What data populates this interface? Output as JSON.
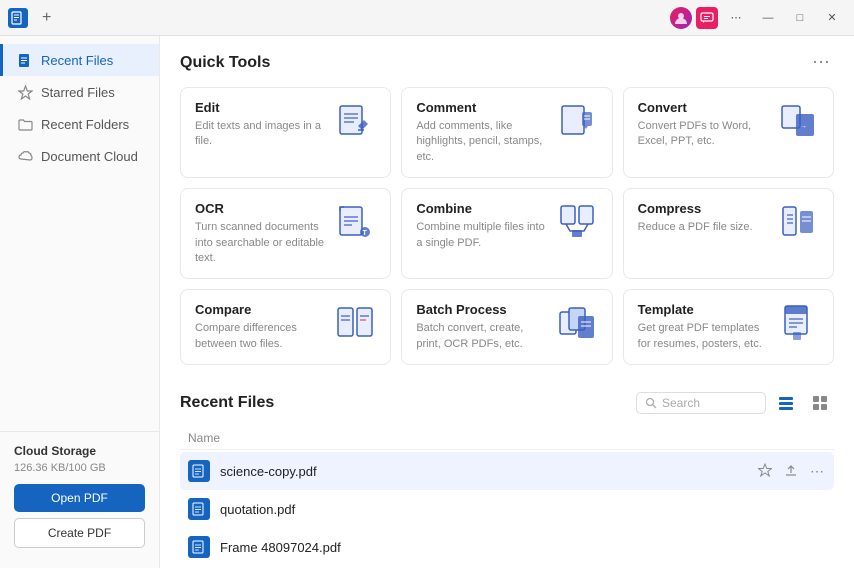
{
  "titlebar": {
    "app_name": "PDF",
    "add_label": "+",
    "dots_label": "⋯",
    "minimize_label": "—",
    "maximize_label": "□",
    "close_label": "✕"
  },
  "sidebar": {
    "items": [
      {
        "id": "recent-files",
        "label": "Recent Files",
        "icon": "📄",
        "active": true
      },
      {
        "id": "starred-files",
        "label": "Starred Files",
        "icon": "☆",
        "active": false
      },
      {
        "id": "recent-folders",
        "label": "Recent Folders",
        "icon": "📁",
        "active": false
      },
      {
        "id": "document-cloud",
        "label": "Document Cloud",
        "icon": "☁",
        "active": false
      }
    ],
    "cloud_storage": {
      "label": "Cloud Storage",
      "size": "126.36 KB/100 GB",
      "open_pdf_label": "Open PDF",
      "create_pdf_label": "Create PDF"
    }
  },
  "quick_tools": {
    "title": "Quick Tools",
    "more_icon": "⋯",
    "tools": [
      {
        "id": "edit",
        "name": "Edit",
        "desc": "Edit texts and images in a file.",
        "icon_color": "#1565c0"
      },
      {
        "id": "comment",
        "name": "Comment",
        "desc": "Add comments, like highlights, pencil, stamps, etc.",
        "icon_color": "#1565c0"
      },
      {
        "id": "convert",
        "name": "Convert",
        "desc": "Convert PDFs to Word, Excel, PPT, etc.",
        "icon_color": "#1565c0"
      },
      {
        "id": "ocr",
        "name": "OCR",
        "desc": "Turn scanned documents into searchable or editable text.",
        "icon_color": "#1565c0"
      },
      {
        "id": "combine",
        "name": "Combine",
        "desc": "Combine multiple files into a single PDF.",
        "icon_color": "#1565c0"
      },
      {
        "id": "compress",
        "name": "Compress",
        "desc": "Reduce a PDF file size.",
        "icon_color": "#1565c0"
      },
      {
        "id": "compare",
        "name": "Compare",
        "desc": "Compare differences between two files.",
        "icon_color": "#1565c0"
      },
      {
        "id": "batch-process",
        "name": "Batch Process",
        "desc": "Batch convert, create, print, OCR PDFs, etc.",
        "icon_color": "#1565c0"
      },
      {
        "id": "template",
        "name": "Template",
        "desc": "Get great PDF templates for resumes, posters, etc.",
        "icon_color": "#1565c0"
      }
    ]
  },
  "recent_files": {
    "title": "Recent Files",
    "search_placeholder": "Search",
    "column_name": "Name",
    "files": [
      {
        "id": "science-copy",
        "name": "science-copy.pdf",
        "highlighted": true
      },
      {
        "id": "quotation",
        "name": "quotation.pdf",
        "highlighted": false
      },
      {
        "id": "frame",
        "name": "Frame 48097024.pdf",
        "highlighted": false
      }
    ]
  }
}
